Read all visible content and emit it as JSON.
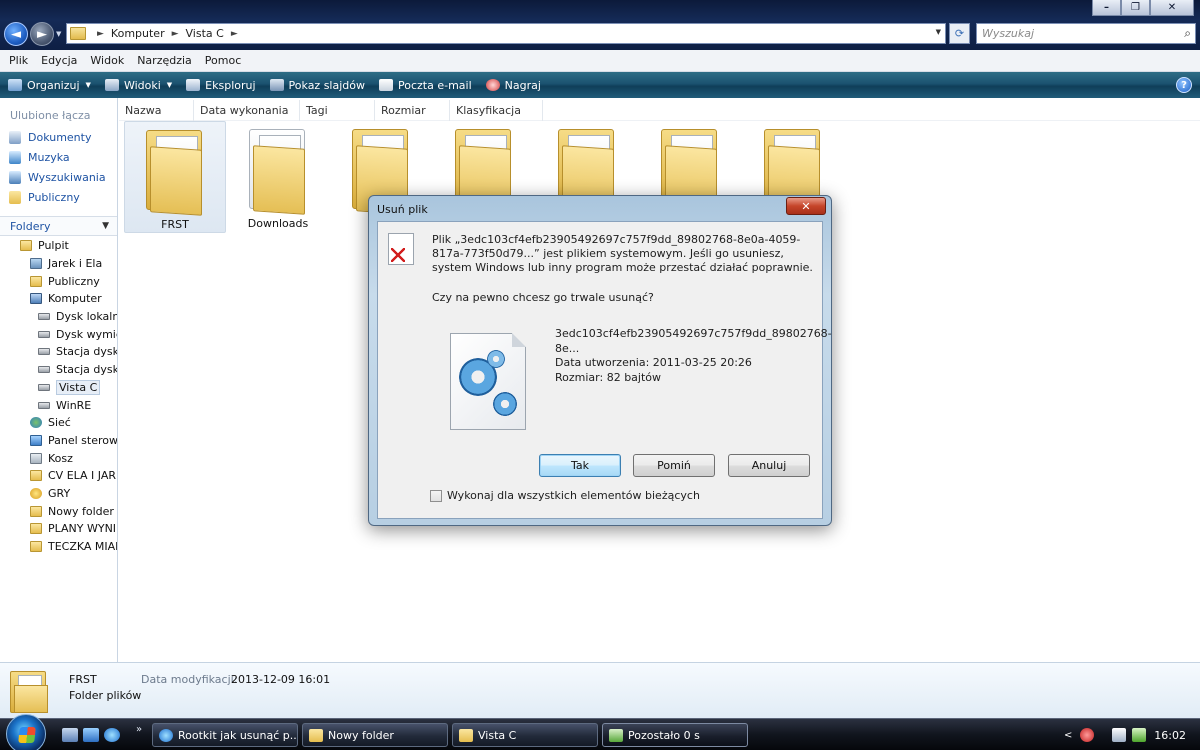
{
  "window": {
    "controls": {
      "minimize": "–",
      "maximize": "❐",
      "close": "✕"
    },
    "nav": {
      "back": "◄",
      "forward": "►"
    },
    "address": {
      "segments": [
        "Komputer",
        "Vista C"
      ],
      "separator": "►"
    },
    "search_placeholder": "Wyszukaj"
  },
  "menu": [
    "Plik",
    "Edycja",
    "Widok",
    "Narzędzia",
    "Pomoc"
  ],
  "toolbar": [
    {
      "label": "Organizuj",
      "icon": "organize-icon",
      "dropdown": true
    },
    {
      "label": "Widoki",
      "icon": "views-icon",
      "dropdown": true
    },
    {
      "label": "Eksploruj",
      "icon": "explore-icon",
      "dropdown": false
    },
    {
      "label": "Pokaz slajdów",
      "icon": "slideshow-icon",
      "dropdown": false
    },
    {
      "label": "Poczta e-mail",
      "icon": "email-icon",
      "dropdown": false
    },
    {
      "label": "Nagraj",
      "icon": "burn-icon",
      "dropdown": false
    }
  ],
  "sidebar": {
    "favorites_title": "Ulubione łącza",
    "links": [
      {
        "label": "Dokumenty",
        "icon": "documents-icon"
      },
      {
        "label": "Muzyka",
        "icon": "music-icon"
      },
      {
        "label": "Wyszukiwania",
        "icon": "searches-icon"
      },
      {
        "label": "Publiczny",
        "icon": "public-folder-icon"
      }
    ],
    "folders_title": "Foldery",
    "tree": [
      {
        "label": "Pulpit",
        "indent": 0,
        "type": "folder"
      },
      {
        "label": "Jarek i Ela",
        "indent": 1,
        "type": "user"
      },
      {
        "label": "Publiczny",
        "indent": 1,
        "type": "folder"
      },
      {
        "label": "Komputer",
        "indent": 1,
        "type": "pc"
      },
      {
        "label": "Dysk lokalny",
        "indent": 2,
        "type": "drive"
      },
      {
        "label": "Dysk wymie",
        "indent": 2,
        "type": "drive"
      },
      {
        "label": "Stacja dyskó",
        "indent": 2,
        "type": "drive"
      },
      {
        "label": "Stacja dyskó",
        "indent": 2,
        "type": "drive"
      },
      {
        "label": "Vista C",
        "indent": 2,
        "type": "drive",
        "selected": true
      },
      {
        "label": "WinRE",
        "indent": 2,
        "type": "drive"
      },
      {
        "label": "Sieć",
        "indent": 1,
        "type": "net"
      },
      {
        "label": "Panel sterowa",
        "indent": 1,
        "type": "ctrl"
      },
      {
        "label": "Kosz",
        "indent": 1,
        "type": "bin"
      },
      {
        "label": "CV ELA I JARE",
        "indent": 1,
        "type": "folder"
      },
      {
        "label": "GRY",
        "indent": 1,
        "type": "game"
      },
      {
        "label": "Nowy folder (",
        "indent": 1,
        "type": "folder"
      },
      {
        "label": "PLANY WYNII",
        "indent": 1,
        "type": "folder"
      },
      {
        "label": "TECZKA MIAN",
        "indent": 1,
        "type": "folder"
      }
    ]
  },
  "columns": [
    "Nazwa",
    "Data wykonania",
    "Tagi",
    "Rozmiar",
    "Klasyfikacja"
  ],
  "files": [
    {
      "name": "FRST",
      "selected": true
    },
    {
      "name": "Downloads"
    },
    {
      "name": ""
    },
    {
      "name": ""
    },
    {
      "name": ""
    },
    {
      "name": ""
    },
    {
      "name": ""
    }
  ],
  "details": {
    "name": "FRST",
    "type": "Folder plików",
    "modified_label": "Data modyfikacji:",
    "modified_value": "2013-12-09 16:01"
  },
  "dialog": {
    "title": "Usuń plik",
    "close": "✕",
    "message": "Plik „3edc103cf4efb23905492697c757f9dd_89802768-8e0a-4059-817a-773f50d79...” jest plikiem systemowym. Jeśli go usuniesz, system Windows lub inny program może przestać działać poprawnie.",
    "question": "Czy na pewno chcesz go trwale usunąć?",
    "file_name": "3edc103cf4efb23905492697c757f9dd_89802768-8e...",
    "file_created": "Data utworzenia: 2011-03-25 20:26",
    "file_size": "Rozmiar: 82 bajtów",
    "buttons": {
      "yes": "Tak",
      "skip": "Pomiń",
      "cancel": "Anuluj"
    },
    "checkbox": "Wykonaj dla wszystkich elementów bieżących"
  },
  "taskbar": {
    "chevron": "»",
    "buttons": [
      {
        "label": "Rootkit jak usunąć p...",
        "icon": "ie-icon"
      },
      {
        "label": "Nowy folder",
        "icon": "folder-icon"
      },
      {
        "label": "Vista C",
        "icon": "folder-icon"
      },
      {
        "label": "Pozostało 0 s",
        "icon": "progress-icon",
        "active": true
      }
    ],
    "tray_chevron": "<",
    "clock": "16:02"
  },
  "colors": {
    "link_blue": "#1e53a3",
    "toolbar_teal": "#1b5270",
    "dialog_frame": "#b7cfe3"
  }
}
